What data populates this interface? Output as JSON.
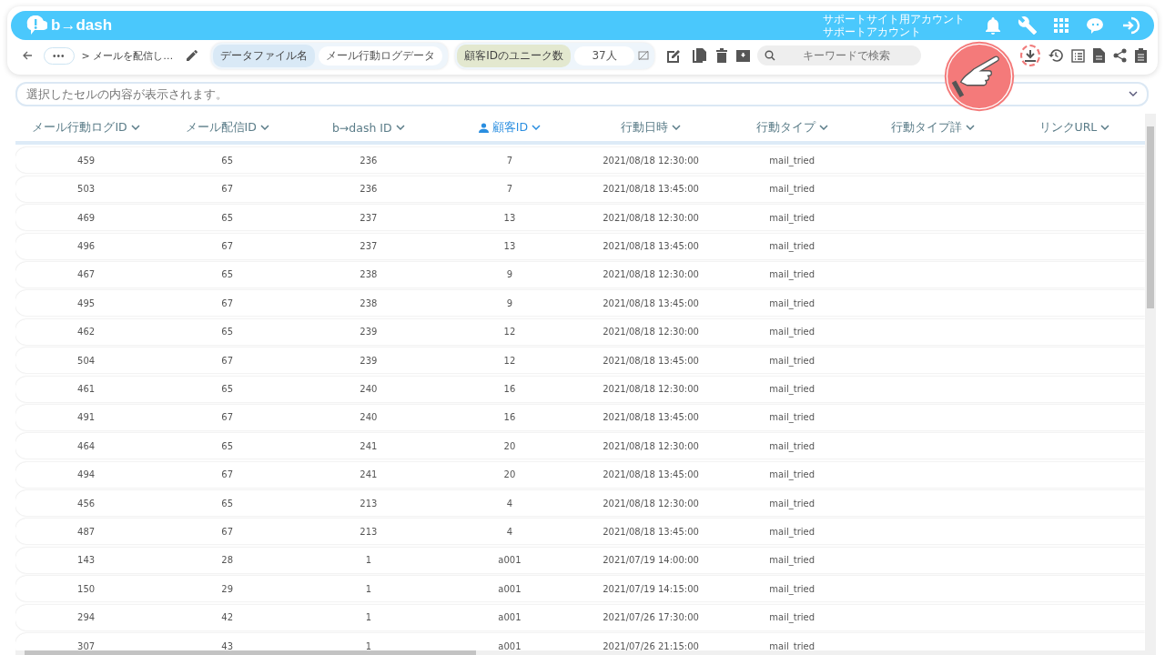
{
  "app": {
    "logo": "b→dash",
    "account": [
      "サポートサイト用アカウント",
      "サポートアカウント"
    ]
  },
  "toolbar": {
    "more": "•••",
    "breadcrumb": "> メールを配信し…",
    "file_label": "データファイル名",
    "file_name": "メール行動ログデータ",
    "unique_label": "顧客IDのユニーク数",
    "unique_count": "37人",
    "search": {
      "placeholder": "キーワードで検索"
    }
  },
  "cell_viewer": {
    "placeholder": "選択したセルの内容が表示されます。"
  },
  "table": {
    "columns": [
      {
        "label": "メール行動ログID",
        "key": false
      },
      {
        "label": "メール配信ID",
        "key": false
      },
      {
        "label": "b→dash ID",
        "key": false
      },
      {
        "label": "顧客ID",
        "key": true
      },
      {
        "label": "行動日時",
        "key": false
      },
      {
        "label": "行動タイプ",
        "key": false
      },
      {
        "label": "行動タイプ詳",
        "key": false
      },
      {
        "label": "リンクURL",
        "key": false
      }
    ],
    "rows": [
      [
        "459",
        "65",
        "236",
        "7",
        "2021/08/18 12:30:00",
        "mail_tried"
      ],
      [
        "503",
        "67",
        "236",
        "7",
        "2021/08/18 13:45:00",
        "mail_tried"
      ],
      [
        "469",
        "65",
        "237",
        "13",
        "2021/08/18 12:30:00",
        "mail_tried"
      ],
      [
        "496",
        "67",
        "237",
        "13",
        "2021/08/18 13:45:00",
        "mail_tried"
      ],
      [
        "467",
        "65",
        "238",
        "9",
        "2021/08/18 12:30:00",
        "mail_tried"
      ],
      [
        "495",
        "67",
        "238",
        "9",
        "2021/08/18 13:45:00",
        "mail_tried"
      ],
      [
        "462",
        "65",
        "239",
        "12",
        "2021/08/18 12:30:00",
        "mail_tried"
      ],
      [
        "504",
        "67",
        "239",
        "12",
        "2021/08/18 13:45:00",
        "mail_tried"
      ],
      [
        "461",
        "65",
        "240",
        "16",
        "2021/08/18 12:30:00",
        "mail_tried"
      ],
      [
        "491",
        "67",
        "240",
        "16",
        "2021/08/18 13:45:00",
        "mail_tried"
      ],
      [
        "464",
        "65",
        "241",
        "20",
        "2021/08/18 12:30:00",
        "mail_tried"
      ],
      [
        "494",
        "67",
        "241",
        "20",
        "2021/08/18 13:45:00",
        "mail_tried"
      ],
      [
        "456",
        "65",
        "213",
        "4",
        "2021/08/18 12:30:00",
        "mail_tried"
      ],
      [
        "487",
        "67",
        "213",
        "4",
        "2021/08/18 13:45:00",
        "mail_tried"
      ],
      [
        "143",
        "28",
        "1",
        "a001",
        "2021/07/19 14:00:00",
        "mail_tried"
      ],
      [
        "150",
        "29",
        "1",
        "a001",
        "2021/07/19 14:15:00",
        "mail_tried"
      ],
      [
        "294",
        "42",
        "1",
        "a001",
        "2021/07/26 17:30:00",
        "mail_tried"
      ],
      [
        "307",
        "43",
        "1",
        "a001",
        "2021/07/26 21:15:00",
        "mail_tried"
      ]
    ]
  }
}
